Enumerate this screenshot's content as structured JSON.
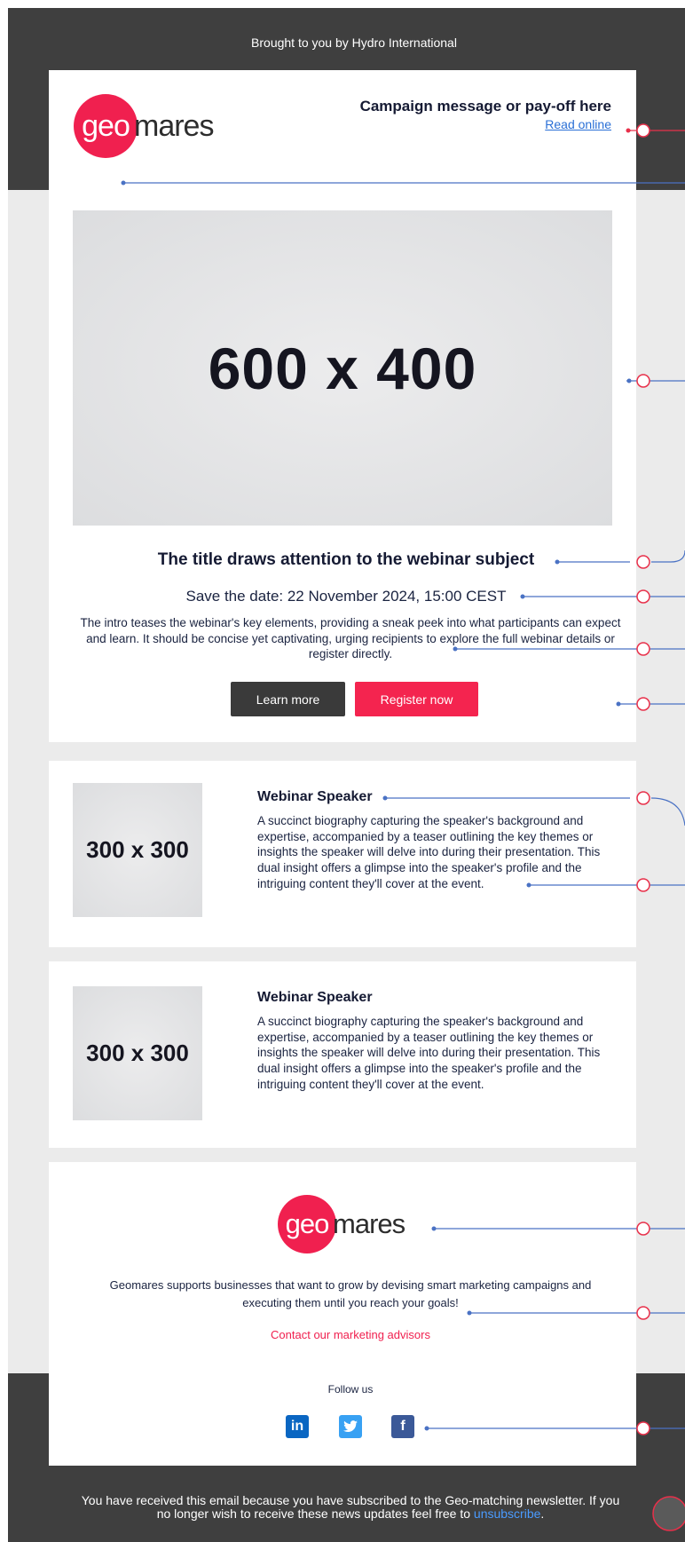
{
  "header": {
    "brought_by": "Brought to you by Hydro International",
    "logo": {
      "circle": "geo",
      "word": "mares"
    },
    "campaign": "Campaign message or pay-off here",
    "read_online": "Read online"
  },
  "hero": {
    "placeholder": "600 x 400",
    "title": "The title draws attention to the webinar subject",
    "save_date": "Save the date: 22 November 2024, 15:00 CEST",
    "intro": "The intro teases the webinar's key elements, providing a sneak peek into what participants can expect and learn. It should be concise yet captivating, urging recipients to explore the full webinar details or register directly.",
    "learn_more": "Learn more",
    "register_now": "Register now"
  },
  "speakers": [
    {
      "placeholder": "300 x 300",
      "name": "Webinar Speaker",
      "bio": "A succinct biography capturing the speaker's background and expertise, accompanied by a teaser outlining the key themes or insights the speaker will delve into during their presentation. This dual insight offers a glimpse into the speaker's profile and the intriguing content they'll cover at the event."
    },
    {
      "placeholder": "300 x 300",
      "name": "Webinar Speaker",
      "bio": "A succinct biography capturing the speaker's background and expertise, accompanied by a teaser outlining the key themes or insights the speaker will delve into during their presentation. This dual insight offers a glimpse into the speaker's profile and the intriguing content they'll cover at the event."
    }
  ],
  "footer": {
    "logo": {
      "circle": "geo",
      "word": "mares"
    },
    "supports": "Geomares supports businesses that want to grow by devising smart marketing campaigns and executing them until you reach your goals!",
    "contact": "Contact our marketing advisors",
    "follow_us": "Follow us",
    "social": {
      "linkedin": "in",
      "twitter": "t",
      "facebook": "f"
    },
    "notice_prefix": "You have received this email because you have subscribed to the Geo-matching newsletter. If you no longer wish to receive these news updates feel free to",
    "unsubscribe": "unsubscribe",
    "notice_suffix": "."
  },
  "colors": {
    "brand_pink": "#f0204f",
    "dark_band": "#3f3f3f",
    "annotation_blue": "#4a72c4",
    "annotation_red": "#e8304a"
  }
}
